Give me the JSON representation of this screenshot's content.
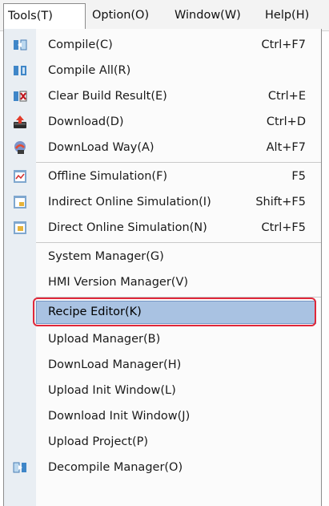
{
  "menubar": {
    "items": [
      {
        "label": "Tools(T)",
        "active": true
      },
      {
        "label": "Option(O)",
        "active": false
      },
      {
        "label": "Window(W)",
        "active": false
      },
      {
        "label": "Help(H)",
        "active": false
      }
    ]
  },
  "menu": {
    "items": [
      {
        "label": "Compile(C)",
        "shortcut": "Ctrl+F7",
        "icon": "compile-icon"
      },
      {
        "label": "Compile All(R)",
        "shortcut": "",
        "icon": "compile-all-icon"
      },
      {
        "label": "Clear Build Result(E)",
        "shortcut": "Ctrl+E",
        "icon": "clear-build-icon"
      },
      {
        "label": "Download(D)",
        "shortcut": "Ctrl+D",
        "icon": "download-icon"
      },
      {
        "label": "DownLoad Way(A)",
        "shortcut": "Alt+F7",
        "icon": "download-way-icon"
      },
      {
        "label": "Offline Simulation(F)",
        "shortcut": "F5",
        "icon": "offline-simulation-icon"
      },
      {
        "label": "Indirect Online Simulation(I)",
        "shortcut": "Shift+F5",
        "icon": "indirect-simulation-icon"
      },
      {
        "label": "Direct Online Simulation(N)",
        "shortcut": "Ctrl+F5",
        "icon": "direct-simulation-icon"
      },
      {
        "label": "System Manager(G)",
        "shortcut": "",
        "icon": ""
      },
      {
        "label": "HMI Version Manager(V)",
        "shortcut": "",
        "icon": ""
      },
      {
        "label": "Recipe Editor(K)",
        "shortcut": "",
        "icon": "",
        "highlighted": true
      },
      {
        "label": "Upload Manager(B)",
        "shortcut": "",
        "icon": ""
      },
      {
        "label": "DownLoad Manager(H)",
        "shortcut": "",
        "icon": ""
      },
      {
        "label": "Upload Init Window(L)",
        "shortcut": "",
        "icon": ""
      },
      {
        "label": "Download Init Window(J)",
        "shortcut": "",
        "icon": ""
      },
      {
        "label": "Upload Project(P)",
        "shortcut": "",
        "icon": ""
      },
      {
        "label": "Decompile Manager(O)",
        "shortcut": "",
        "icon": "decompile-icon"
      }
    ]
  },
  "colors": {
    "highlight": "#a9c2e2",
    "annotation": "#e0283a"
  }
}
